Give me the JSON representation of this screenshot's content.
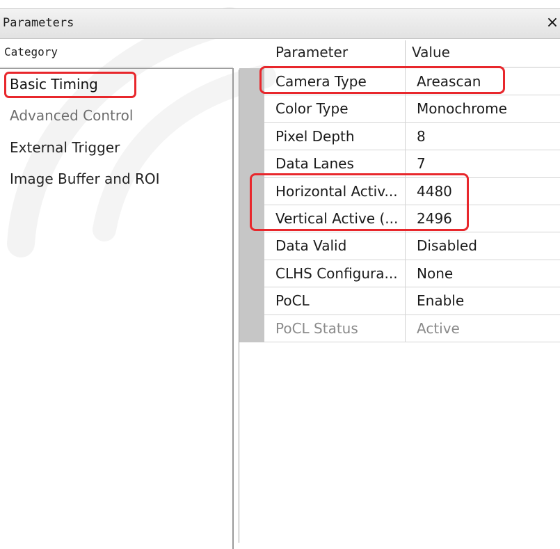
{
  "window": {
    "title": "Parameters",
    "close_glyph": "×"
  },
  "category_panel": {
    "header": "Category",
    "items": [
      {
        "label": "Basic Timing",
        "state": "selected"
      },
      {
        "label": "Advanced Control",
        "state": "muted"
      },
      {
        "label": "External Trigger",
        "state": "normal"
      },
      {
        "label": "Image Buffer and ROI",
        "state": "normal"
      }
    ]
  },
  "parameter_grid": {
    "headers": {
      "parameter": "Parameter",
      "value": "Value"
    },
    "rows": [
      {
        "parameter": "Camera Type",
        "value": "Areascan"
      },
      {
        "parameter": "Color Type",
        "value": "Monochrome"
      },
      {
        "parameter": "Pixel Depth",
        "value": "8"
      },
      {
        "parameter": "Data Lanes",
        "value": "7"
      },
      {
        "parameter": "Horizontal Activ...",
        "value": "4480"
      },
      {
        "parameter": "Vertical Active (...",
        "value": "2496"
      },
      {
        "parameter": "Data Valid",
        "value": "Disabled"
      },
      {
        "parameter": "CLHS Configura...",
        "value": "None"
      },
      {
        "parameter": "PoCL",
        "value": "Enable"
      },
      {
        "parameter": "PoCL Status",
        "value": "Active",
        "disabled": true
      }
    ]
  },
  "annotation_color": "#e8272c"
}
